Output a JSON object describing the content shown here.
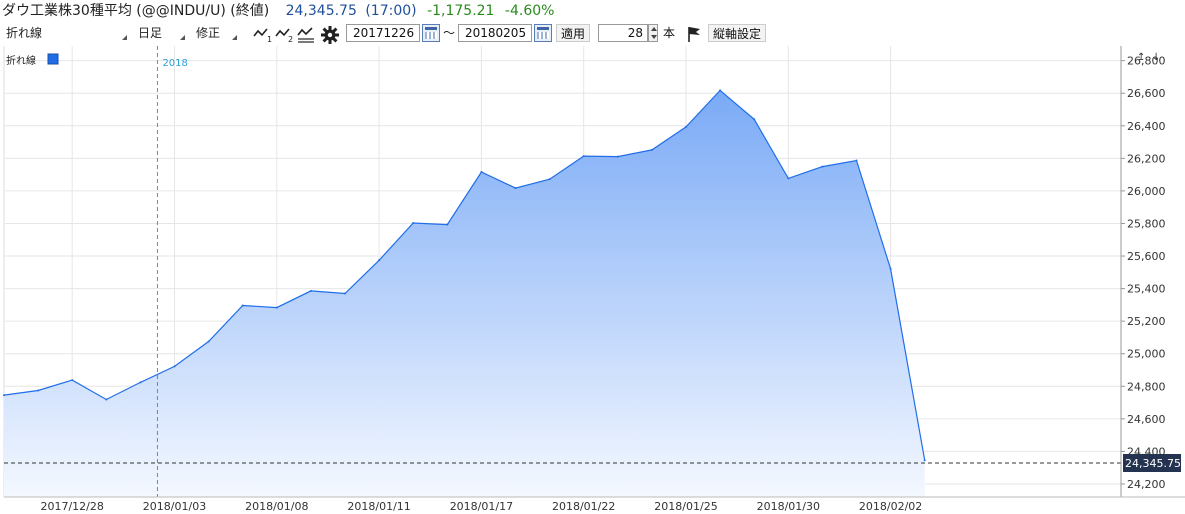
{
  "header": {
    "name": "ダウ工業株30種平均 (@@INDU/U) (終値)",
    "price": "24,345.75",
    "time": "(17:00)",
    "change": "-1,175.21",
    "percent": "-4.60%"
  },
  "toolbar": {
    "chart_type": "折れ線",
    "period": "日足",
    "adjust": "修正",
    "start_date": "20171226",
    "tilde": "〜",
    "end_date": "20180205",
    "apply_label": "適用",
    "count": "28",
    "count_unit": "本",
    "axis_settings_label": "縦軸設定",
    "icons": [
      "line-1-icon",
      "line-2-icon",
      "line-indicator-icon",
      "gear-icon",
      "calendar-icon",
      "flag-icon"
    ]
  },
  "colors": {
    "line": "#1f6ee8",
    "fill_top": "#7aaaf6",
    "fill_bottom": "#f4f8ff",
    "year_marker": "#2aa0d8",
    "last_price_bg": "#24334f"
  },
  "chart_data": {
    "type": "area",
    "legend": "折れ線",
    "year_marker": "2018",
    "last_price_label": "24,345.75",
    "x": [
      "2017/12/26",
      "2017/12/27",
      "2017/12/28",
      "2017/12/29",
      "2018/01/02",
      "2018/01/03",
      "2018/01/04",
      "2018/01/05",
      "2018/01/08",
      "2018/01/09",
      "2018/01/10",
      "2018/01/11",
      "2018/01/12",
      "2018/01/16",
      "2018/01/17",
      "2018/01/18",
      "2018/01/19",
      "2018/01/22",
      "2018/01/23",
      "2018/01/24",
      "2018/01/25",
      "2018/01/26",
      "2018/01/29",
      "2018/01/30",
      "2018/01/31",
      "2018/02/01",
      "2018/02/02",
      "2018/02/05"
    ],
    "values": [
      24746,
      24774,
      24838,
      24719,
      24824,
      24922,
      25075,
      25296,
      25283,
      25386,
      25370,
      25574,
      25803,
      25793,
      26116,
      26017,
      26072,
      26214,
      26211,
      26252,
      26393,
      26617,
      26440,
      26077,
      26149,
      26187,
      25521,
      24346
    ],
    "x_tick_labels": [
      "2017/12/28",
      "2018/01/03",
      "2018/01/08",
      "2018/01/11",
      "2018/01/17",
      "2018/01/22",
      "2018/01/25",
      "2018/01/30",
      "2018/02/02"
    ],
    "y_ticks": [
      24200,
      24400,
      24600,
      24800,
      25000,
      25200,
      25400,
      25600,
      25800,
      26000,
      26200,
      26400,
      26600,
      26800
    ],
    "y_tick_labels": [
      "24,200",
      "24,400",
      "24,600",
      "24,800",
      "25,000",
      "25,200",
      "25,400",
      "25,600",
      "25,800",
      "26,000",
      "26,200",
      "26,400",
      "26,600",
      "26,800"
    ],
    "ylim": [
      24120,
      26890
    ],
    "grid": true,
    "legend_position": "top-left"
  }
}
